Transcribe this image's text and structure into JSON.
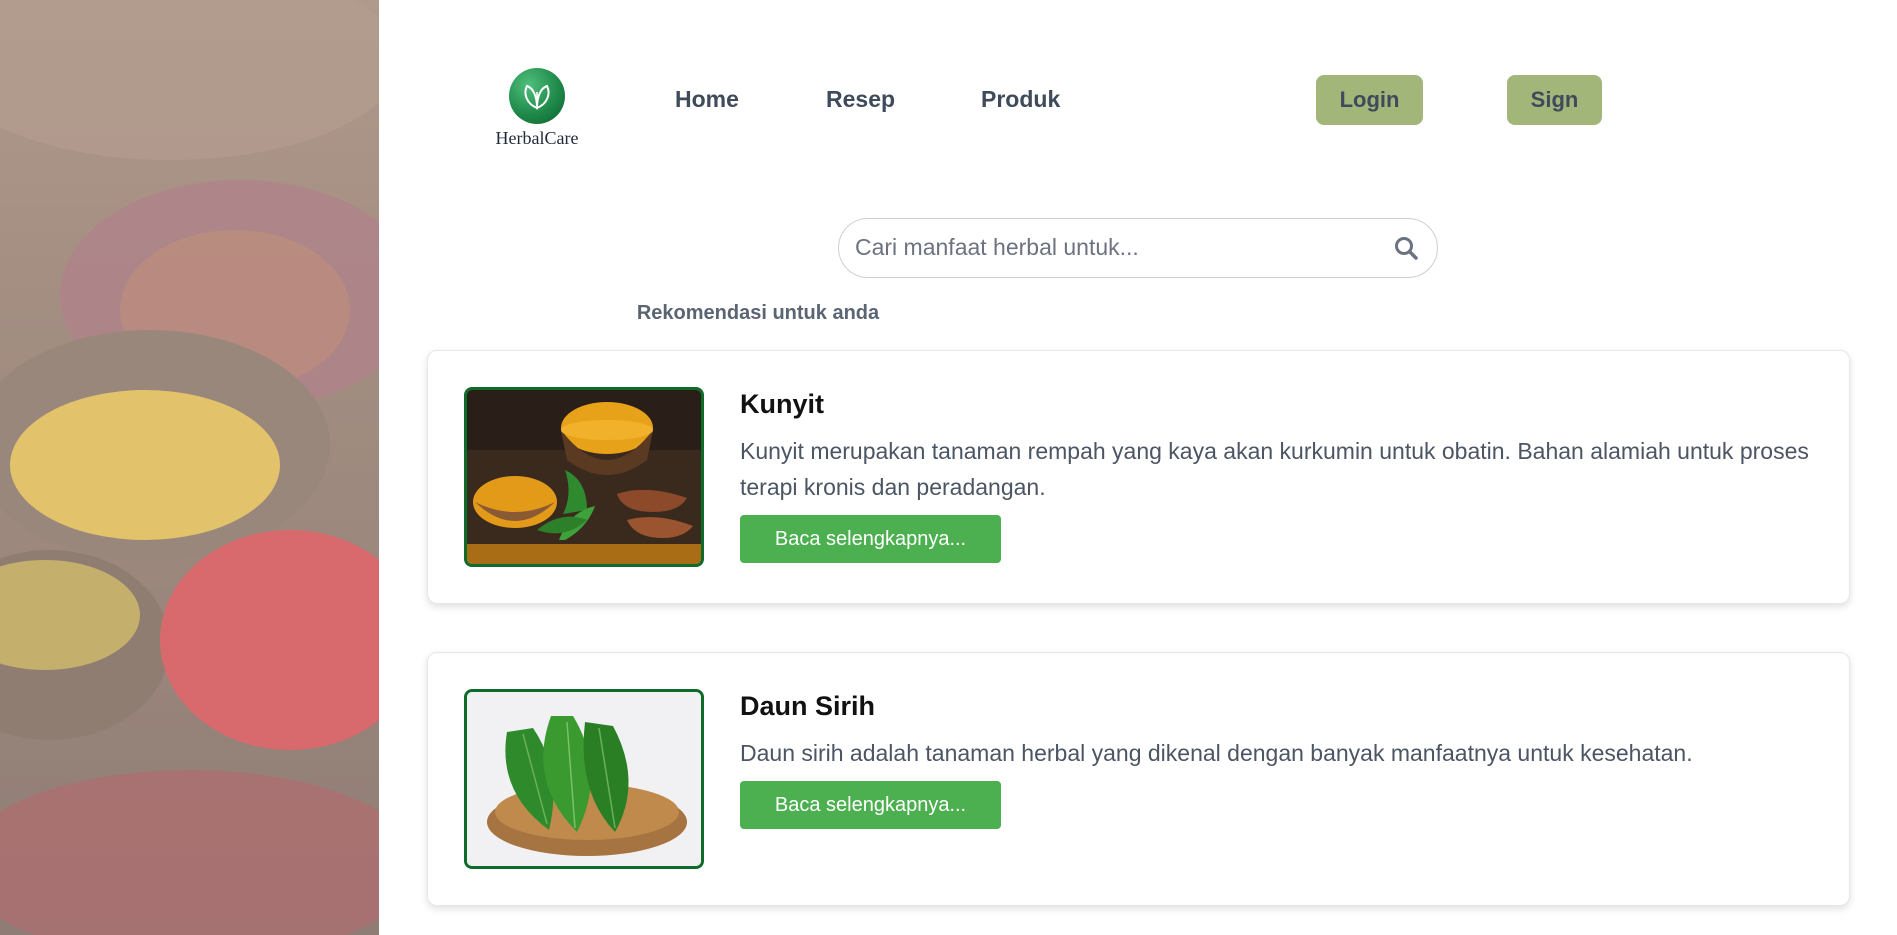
{
  "brand": {
    "name": "HerbalCare",
    "logo_icon": "leaf-icon",
    "color": "#1f8a4a"
  },
  "nav": {
    "links": [
      {
        "label": "Home"
      },
      {
        "label": "Resep"
      },
      {
        "label": "Produk"
      }
    ],
    "login_label": "Login",
    "sign_label": "Sign",
    "auth_color": "#a3b67a"
  },
  "search": {
    "placeholder": "Cari manfaat herbal untuk...",
    "value": "",
    "icon": "search-icon"
  },
  "recommendations": {
    "title": "Rekomendasi untuk anda",
    "items": [
      {
        "title": "Kunyit",
        "description": "Kunyit merupakan tanaman rempah yang kaya akan kurkumin untuk obatin. Bahan alamiah untuk proses terapi kronis dan peradangan.",
        "button_label": "Baca selengkapnya..."
      },
      {
        "title": "Daun Sirih",
        "description": "Daun sirih adalah tanaman herbal yang dikenal dengan banyak manfaatnya untuk kesehatan.",
        "button_label": "Baca selengkapnya..."
      }
    ],
    "button_color": "#4caf50"
  }
}
